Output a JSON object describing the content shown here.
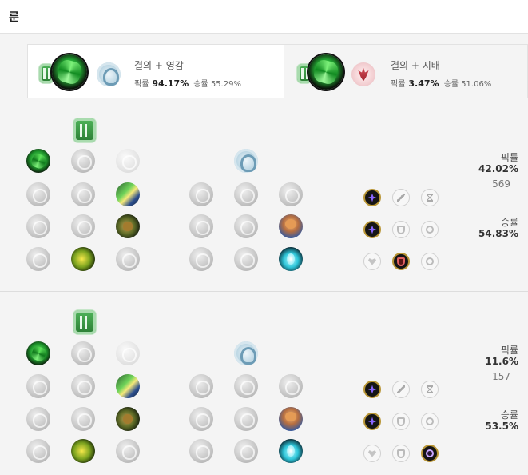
{
  "header": {
    "title": "룬"
  },
  "tabs": [
    {
      "name": "결의 + 영감",
      "pick_label": "픽률",
      "pick_value": "94.17%",
      "win_label": "승률",
      "win_value": "55.29%",
      "primary_icon": "resolve-shield-icon",
      "keystone_icon": "grasp-keystone-icon",
      "secondary_icon": "inspiration-tree-icon"
    },
    {
      "name": "결의 + 지배",
      "pick_label": "픽률",
      "pick_value": "3.47%",
      "win_label": "승률",
      "win_value": "51.06%",
      "primary_icon": "resolve-shield-icon",
      "keystone_icon": "grasp-keystone-icon",
      "secondary_icon": "domination-tree-icon"
    }
  ],
  "pages": [
    {
      "pick_label": "픽률",
      "pick_value": "42.02%",
      "games": "569",
      "win_label": "승률",
      "win_value": "54.83%"
    },
    {
      "pick_label": "픽률",
      "pick_value": "11.6%",
      "games": "157",
      "win_label": "승률",
      "win_value": "53.5%"
    }
  ],
  "colors": {
    "selected_shard_border": "#b89535",
    "background": "#f4f4f4"
  }
}
